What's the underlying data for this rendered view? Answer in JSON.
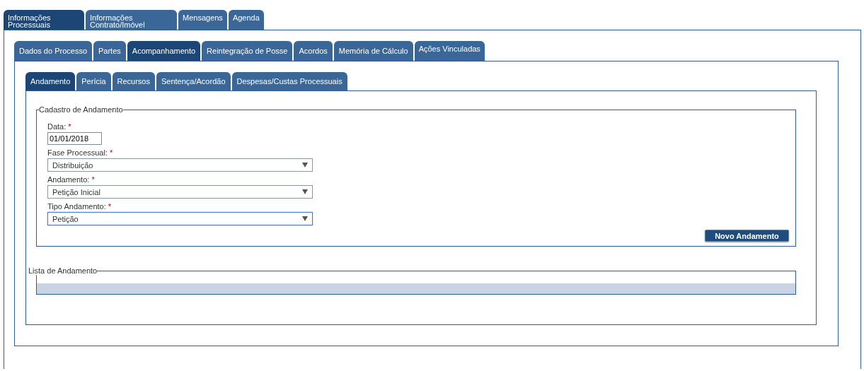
{
  "main_tabs": [
    {
      "label": "Informações Processuais",
      "selected": true
    },
    {
      "label": "Informações Contrato/Imóvel",
      "selected": false
    },
    {
      "label": "Mensagens",
      "selected": false
    },
    {
      "label": "Agenda",
      "selected": false
    }
  ],
  "process_tabs": [
    {
      "label": "Dados do Processo",
      "selected": false
    },
    {
      "label": "Partes",
      "selected": false
    },
    {
      "label": "Acompanhamento",
      "selected": true
    },
    {
      "label": "Reintegração de Posse",
      "selected": false
    },
    {
      "label": "Acordos",
      "selected": false
    },
    {
      "label": "Memória de Cálculo",
      "selected": false
    },
    {
      "label": "Ações Vinculadas",
      "selected": false
    }
  ],
  "tracking_tabs": [
    {
      "label": "Andamento",
      "selected": true
    },
    {
      "label": "Perícia",
      "selected": false
    },
    {
      "label": "Recursos",
      "selected": false
    },
    {
      "label": "Sentença/Acordão",
      "selected": false
    },
    {
      "label": "Despesas/Custas Processuais",
      "selected": false
    }
  ],
  "form": {
    "title": "Cadastro de Andamento",
    "fields": [
      {
        "kind": "text",
        "label": "Data:",
        "required_mark": "*",
        "value": "01/01/2018",
        "focused": false
      },
      {
        "kind": "select",
        "label": "Fase Processual:",
        "required_mark": "*",
        "value": "Distribuição",
        "focused": false
      },
      {
        "kind": "select",
        "label": "Andamento:",
        "required_mark": "*",
        "value": "Petição Inicial",
        "focused": false
      },
      {
        "kind": "select",
        "label": "Tipo Andamento:",
        "required_mark": "*",
        "value": "Petição",
        "focused": true
      }
    ],
    "button": "Novo Andamento"
  },
  "list": {
    "title": "Lista de Andamento"
  }
}
